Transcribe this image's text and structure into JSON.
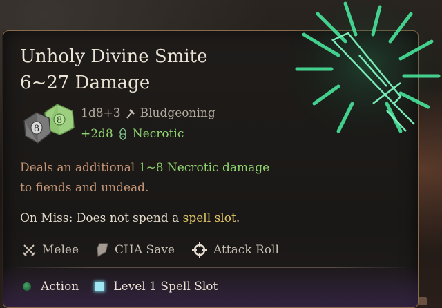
{
  "spell": {
    "name": "Unholy Divine Smite",
    "damage_range": "6~27 Damage"
  },
  "damage_rolls": [
    {
      "dice": "1d8+3",
      "type": "Bludgeoning",
      "type_icon": "mace-icon",
      "color": "#b4ab9f"
    },
    {
      "dice": "+2d8",
      "type": "Necrotic",
      "type_icon": "necrotic-skull-icon",
      "color": "#8fd470"
    }
  ],
  "dice_icons": {
    "front": "8",
    "back": "8"
  },
  "description": {
    "prefix": "Deals an additional ",
    "highlight": "1~8 Necrotic damage",
    "suffix": "to fiends and undead."
  },
  "on_miss": {
    "prefix": "On Miss: Does not spend a ",
    "highlight": "spell slot",
    "suffix": "."
  },
  "properties": [
    {
      "icon": "crossed-swords-icon",
      "label": "Melee"
    },
    {
      "icon": "shield-save-icon",
      "label": "CHA Save"
    },
    {
      "icon": "crosshair-icon",
      "label": "Attack Roll"
    }
  ],
  "costs": [
    {
      "icon": "action-dot-icon",
      "label": "Action",
      "color": "#2f8a50"
    },
    {
      "icon": "spell-slot-icon",
      "label": "Level 1 Spell Slot",
      "color": "#9fe6f2"
    }
  ],
  "colors": {
    "necrotic_green": "#8fd470",
    "description_orange": "#c39577",
    "spell_slot_gold": "#e2c768",
    "border": "#8a6a4c",
    "spell_glow": "#3fd88a"
  }
}
